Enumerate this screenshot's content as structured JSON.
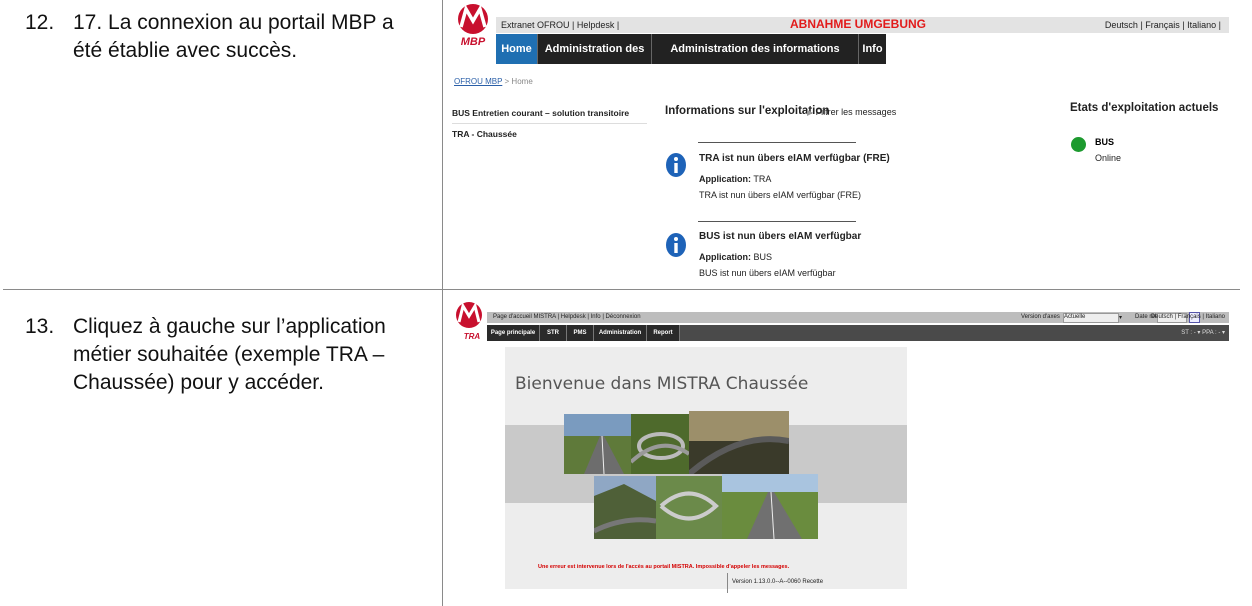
{
  "steps": [
    {
      "number": "12.",
      "text": "17. La connexion au portail MBP a été établie avec succès."
    },
    {
      "number": "13.",
      "text": "Cliquez à gauche sur l’application métier souhaitée (exemple TRA – Chaussée) pour y accéder."
    }
  ],
  "mbp": {
    "logo_text": "MBP",
    "top_links": "Extranet OFROU | Helpdesk |",
    "env_label": "ABNAHME UMGEBUNG",
    "languages": "Deutsch | Français | Italiano |",
    "tabs": [
      "Home",
      "Administration des rôles",
      "Administration des informations d'exploitation",
      "Info"
    ],
    "breadcrumb_link": "OFROU MBP",
    "breadcrumb_rest": " > Home",
    "sidebar": [
      "BUS Entretien courant – solution transitoire",
      "TRA - Chaussée"
    ],
    "center_title": "Informations sur l'exploitation",
    "filter_label": "Filtrer les messages",
    "right_title": "Etats d'exploitation actuels",
    "status": {
      "app": "BUS",
      "state": "Online",
      "color": "#1d9a2f"
    },
    "messages": [
      {
        "title": "TRA ist nun übers eIAM verfügbar (FRE)",
        "app_label": "Application:",
        "app": "TRA",
        "body": "TRA ist nun übers eIAM verfügbar (FRE)"
      },
      {
        "title": "BUS ist nun übers eIAM verfügbar",
        "app_label": "Application:",
        "app": "BUS",
        "body": "BUS ist nun übers eIAM verfügbar"
      }
    ]
  },
  "mistra": {
    "logo_text": "TRA",
    "top_links": "Page d'accueil MISTRA | Helpdesk | Info | Déconnexion",
    "version_label": "Version d'axes",
    "version_value": "Actuelle",
    "date_label": "Date réf.",
    "languages": "Deutsch | Français | Italiano",
    "tabs": [
      "Page principale",
      "STR",
      "PMS",
      "Administration",
      "Report"
    ],
    "nav_right": "ST : -  ▾  PPA : -  ▾",
    "welcome": "Bienvenue dans MISTRA Chaussée",
    "error": "Une erreur est intervenue lors de l'accès au portail MISTRA. Impossible d'appeler les messages.",
    "version": "Version 1.13.0.0--A--0060 Recette"
  },
  "colors": {
    "mbp_red": "#c8102e",
    "nav_dark": "#222222",
    "home_blue": "#1f6fb2",
    "info_blue": "#1e63b8",
    "error_red": "#d40000"
  }
}
